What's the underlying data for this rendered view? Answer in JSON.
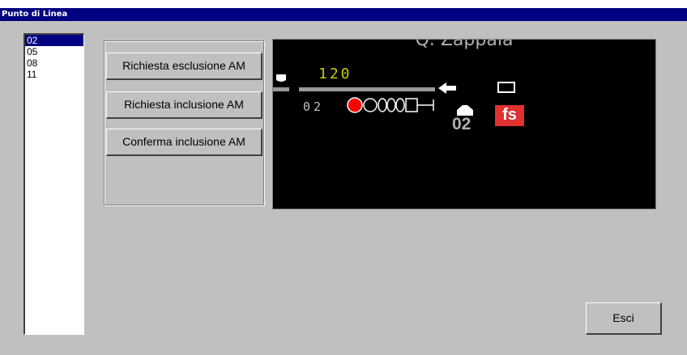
{
  "window": {
    "title": "Punto di Linea"
  },
  "list": {
    "items": [
      "02",
      "05",
      "08",
      "11"
    ],
    "selected_index": 0
  },
  "actions": {
    "exclude": "Richiesta esclusione AM",
    "include": "Richiesta inclusione AM",
    "confirm": "Conferma inclusione AM"
  },
  "display": {
    "station": "Q. Zappala",
    "speed": "120",
    "track_id": "02",
    "line_point_number": "02",
    "fs_badge": "fs",
    "signal_lamps": [
      "red",
      "off",
      "off",
      "off",
      "off"
    ],
    "colors": {
      "background": "#000000",
      "speed": "#c8c800",
      "fs_badge": "#e03030",
      "track": "#9a9a9a"
    }
  },
  "exit_label": "Esci"
}
